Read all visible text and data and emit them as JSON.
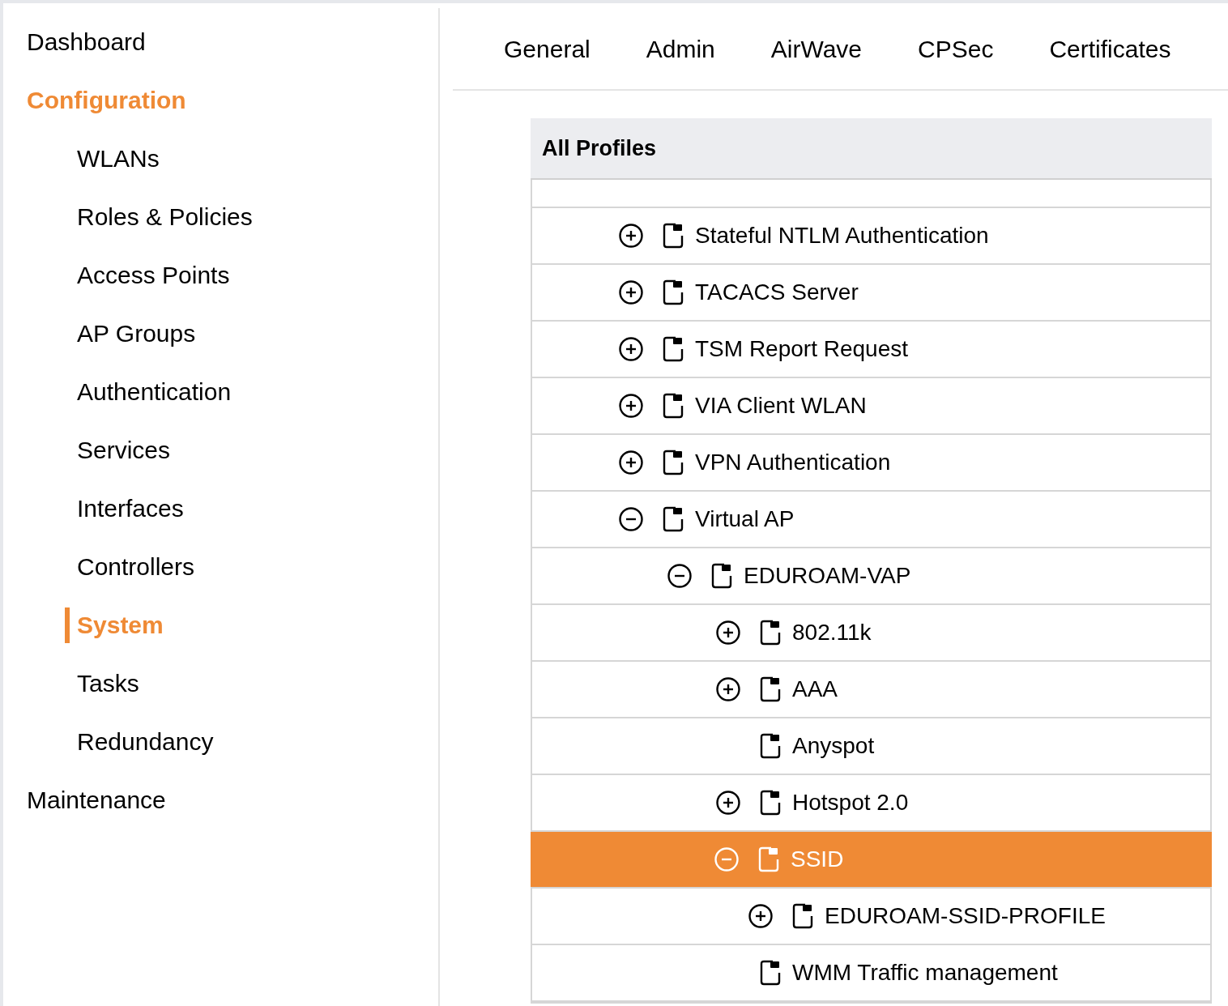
{
  "sidebar": {
    "items": [
      {
        "label": "Dashboard",
        "selected": false
      },
      {
        "label": "Configuration",
        "selected": true,
        "children": [
          {
            "label": "WLANs",
            "selected": false
          },
          {
            "label": "Roles & Policies",
            "selected": false
          },
          {
            "label": "Access Points",
            "selected": false
          },
          {
            "label": "AP Groups",
            "selected": false
          },
          {
            "label": "Authentication",
            "selected": false
          },
          {
            "label": "Services",
            "selected": false
          },
          {
            "label": "Interfaces",
            "selected": false
          },
          {
            "label": "Controllers",
            "selected": false
          },
          {
            "label": "System",
            "selected": true
          },
          {
            "label": "Tasks",
            "selected": false
          },
          {
            "label": "Redundancy",
            "selected": false
          }
        ]
      },
      {
        "label": "Maintenance",
        "selected": false
      }
    ]
  },
  "tabs": [
    {
      "label": "General"
    },
    {
      "label": "Admin"
    },
    {
      "label": "AirWave"
    },
    {
      "label": "CPSec"
    },
    {
      "label": "Certificates"
    }
  ],
  "profiles": {
    "title": "All Profiles",
    "tree": [
      {
        "label": "Stateful NTLM Authentication",
        "kind": "group",
        "expanded": false,
        "selected": false
      },
      {
        "label": "TACACS Server",
        "kind": "group",
        "expanded": false,
        "selected": false
      },
      {
        "label": "TSM Report Request",
        "kind": "group",
        "expanded": false,
        "selected": false
      },
      {
        "label": "VIA Client WLAN",
        "kind": "group",
        "expanded": false,
        "selected": false
      },
      {
        "label": "VPN Authentication",
        "kind": "group",
        "expanded": false,
        "selected": false
      },
      {
        "label": "Virtual AP",
        "kind": "group",
        "expanded": true,
        "selected": false,
        "children": [
          {
            "label": "EDUROAM-VAP",
            "kind": "group",
            "expanded": true,
            "selected": false,
            "children": [
              {
                "label": "802.11k",
                "kind": "group",
                "expanded": false,
                "selected": false
              },
              {
                "label": "AAA",
                "kind": "group",
                "expanded": false,
                "selected": false
              },
              {
                "label": "Anyspot",
                "kind": "leaf",
                "selected": false
              },
              {
                "label": "Hotspot 2.0",
                "kind": "group",
                "expanded": false,
                "selected": false
              },
              {
                "label": "SSID",
                "kind": "group",
                "expanded": true,
                "selected": true,
                "children": [
                  {
                    "label": "EDUROAM-SSID-PROFILE",
                    "kind": "group",
                    "expanded": false,
                    "selected": false
                  }
                ]
              },
              {
                "label": "WMM Traffic management",
                "kind": "leaf",
                "selected": false
              }
            ]
          }
        ]
      }
    ]
  }
}
